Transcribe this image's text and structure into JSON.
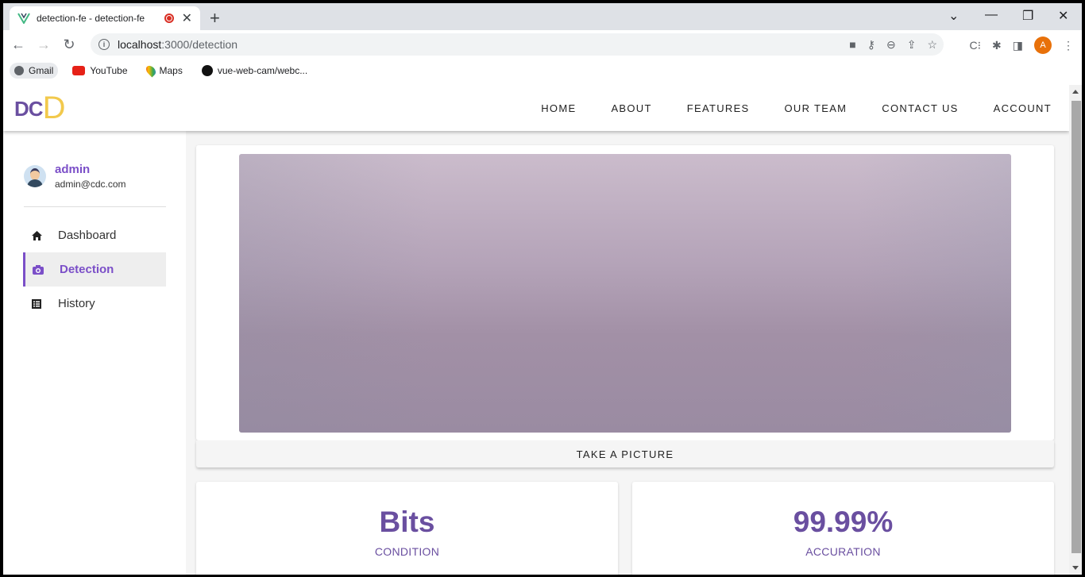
{
  "browser": {
    "tab_title": "detection-fe - detection-fe",
    "url_host": "localhost",
    "url_path": ":3000/detection",
    "bookmarks": [
      "Gmail",
      "YouTube",
      "Maps",
      "vue-web-cam/webc..."
    ],
    "profile_initial": "A"
  },
  "header": {
    "logo_dc": "DC",
    "logo_d": "D",
    "nav": [
      "HOME",
      "ABOUT",
      "FEATURES",
      "OUR TEAM",
      "CONTACT US",
      "ACCOUNT"
    ]
  },
  "sidebar": {
    "user_name": "admin",
    "user_email": "admin@cdc.com",
    "items": [
      {
        "label": "Dashboard",
        "icon": "home-icon"
      },
      {
        "label": "Detection",
        "icon": "camera-icon"
      },
      {
        "label": "History",
        "icon": "list-icon"
      }
    ]
  },
  "main": {
    "take_picture_label": "TAKE A PICTURE",
    "stats": [
      {
        "value": "Bits",
        "label": "CONDITION"
      },
      {
        "value": "99.99%",
        "label": "ACCURATION"
      }
    ]
  },
  "colors": {
    "accent": "#7b4fc8",
    "logo_yellow": "#f2c94c"
  }
}
